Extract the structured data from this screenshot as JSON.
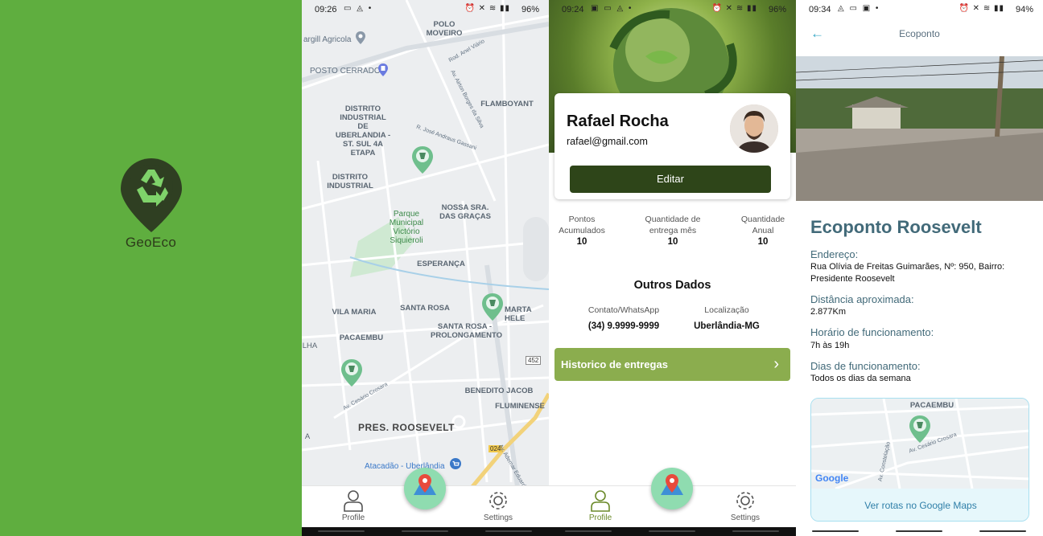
{
  "splash": {
    "brand": "GeoEco",
    "colors": {
      "background": "#5fae3f",
      "pin": "#2f3f22",
      "recycle": "#7fd36a"
    }
  },
  "map_screen": {
    "status": {
      "time": "09:26",
      "battery": "96%"
    },
    "labels": {
      "polo": "POLO MOVEIRO",
      "cargill": "argill Agricola",
      "posto": "POSTO CERRADO",
      "flamboyant": "FLAMBOYANT",
      "distrito_sul": "DISTRITO INDUSTRIAL DE UBERLANDIA - ST. SUL 4A ETAPA",
      "distrito": "DISTRITO INDUSTRIAL",
      "gracas": "NOSSA SRA. DAS GRAÇAS",
      "parque": "Parque Municipal Victório Siquieroli",
      "esperanca": "ESPERANÇA",
      "vila_maria": "VILA MARIA",
      "santa_rosa": "SANTA ROSA",
      "marta": "MARTA HELE",
      "santa_rosa_prol": "SANTA ROSA - PROLONGAMENTO",
      "pacaembu": "PACAEMBU",
      "lha": "LHA",
      "benedito": "BENEDITO JACOB",
      "fluminense": "FLUMINENSE",
      "roosevelt": "PRES. ROOSEVELT",
      "atacadao": "Atacadão - Uberlândia",
      "a": "A",
      "road_452": "452",
      "road_024": "024",
      "street1": "Rod. Anel Viário",
      "street2": "Av. Airton Borges da Silva",
      "street3": "R. José Andraus Gassani",
      "street4": "Av. Cesário Crosara",
      "street5": "Av. Ademar Eduardo"
    },
    "nav": {
      "profile": "Profile",
      "settings": "Settings"
    }
  },
  "profile_screen": {
    "status": {
      "time": "09:24",
      "battery": "96%"
    },
    "name": "Rafael Rocha",
    "email": "rafael@gmail.com",
    "edit_button": "Editar",
    "stats": [
      {
        "label": "Pontos Acumulados",
        "value": "10"
      },
      {
        "label": "Quantidade de entrega mês",
        "value": "10"
      },
      {
        "label": "Quantidade Anual",
        "value": "10"
      }
    ],
    "other_title": "Outros Dados",
    "contact_label": "Contato/WhatsApp",
    "contact_value": "(34) 9.9999-9999",
    "location_label": "Localização",
    "location_value": "Uberlândia-MG",
    "history_button": "Historico de entregas",
    "nav": {
      "profile": "Profile",
      "settings": "Settings"
    }
  },
  "ecoponto_screen": {
    "status": {
      "time": "09:34",
      "battery": "94%"
    },
    "appbar_title": "Ecoponto",
    "title": "Ecoponto Roosevelt",
    "address_label": "Endereço:",
    "address_value": "Rua Olívia de Freitas Guimarães, Nº: 950, Bairro: Presidente Roosevelt",
    "distance_label": "Distância aproximada:",
    "distance_value": "2.877Km",
    "hours_label": "Horário de funcionamento:",
    "hours_value": "7h às 19h",
    "days_label": "Dias de funcionamento:",
    "days_value": "Todos os dias da semana",
    "mini_map": {
      "label": "PACAEMBU",
      "street1": "Av. Cesário Crosara",
      "street2": "Av. Constelação",
      "google": "Google"
    },
    "routes_button": "Ver rotas no Google Maps"
  }
}
